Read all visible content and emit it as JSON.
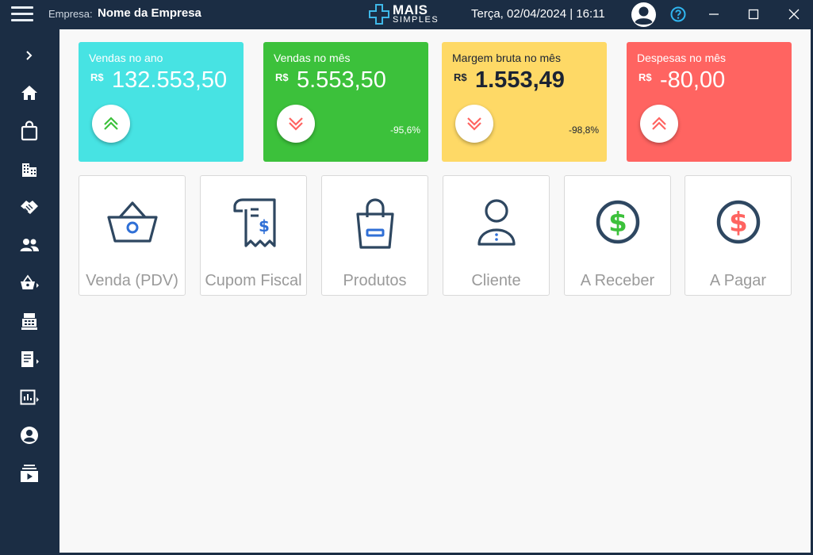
{
  "header": {
    "company_label": "Empresa:",
    "company_name": "Nome da Empresa",
    "logo_line1": "MAIS",
    "logo_line2": "SIMPLES",
    "datetime": "Terça, 02/04/2024 | 16:11"
  },
  "sidebar": {
    "items": [
      {
        "icon": "chevron-right-icon"
      },
      {
        "icon": "home-icon"
      },
      {
        "icon": "shopping-bag-icon"
      },
      {
        "icon": "building-icon"
      },
      {
        "icon": "handshake-icon"
      },
      {
        "icon": "people-icon"
      },
      {
        "icon": "basket-icon"
      },
      {
        "icon": "cash-register-icon"
      },
      {
        "icon": "receipt-icon"
      },
      {
        "icon": "report-chart-icon"
      },
      {
        "icon": "account-icon"
      },
      {
        "icon": "video-library-icon"
      }
    ]
  },
  "cards": [
    {
      "label": "Vendas no ano",
      "currency": "R$",
      "value": "132.553,50",
      "percent": "",
      "trend": "up",
      "bg": "#47e3e3",
      "text": "#ffffff"
    },
    {
      "label": "Vendas no mês",
      "currency": "R$",
      "value": "5.553,50",
      "percent": "-95,6%",
      "trend": "down",
      "bg": "#3cc13b",
      "text": "#ffffff"
    },
    {
      "label": "Margem bruta no mês",
      "currency": "R$",
      "value": "1.553,49",
      "percent": "-98,8%",
      "trend": "down",
      "bg": "#fed966",
      "text": "#1b2333"
    },
    {
      "label": "Despesas no mês",
      "currency": "R$",
      "value": "-80,00",
      "percent": "",
      "trend": "up",
      "bg": "#ff6461",
      "text": "#ffffff"
    }
  ],
  "tiles": [
    {
      "label": "Venda (PDV)",
      "icon": "basket-icon"
    },
    {
      "label": "Cupom Fiscal",
      "icon": "receipt-icon"
    },
    {
      "label": "Produtos",
      "icon": "shopping-bag-icon"
    },
    {
      "label": "Cliente",
      "icon": "client-icon"
    },
    {
      "label": "A Receber",
      "icon": "dollar-green-icon"
    },
    {
      "label": "A Pagar",
      "icon": "dollar-red-icon"
    }
  ],
  "colors": {
    "nav_bg": "#1b2d44",
    "arrow_green": "#3cc13b",
    "arrow_red": "#ff6461",
    "icon_navy": "#2e4761",
    "help_icon": "#30b6f0"
  }
}
